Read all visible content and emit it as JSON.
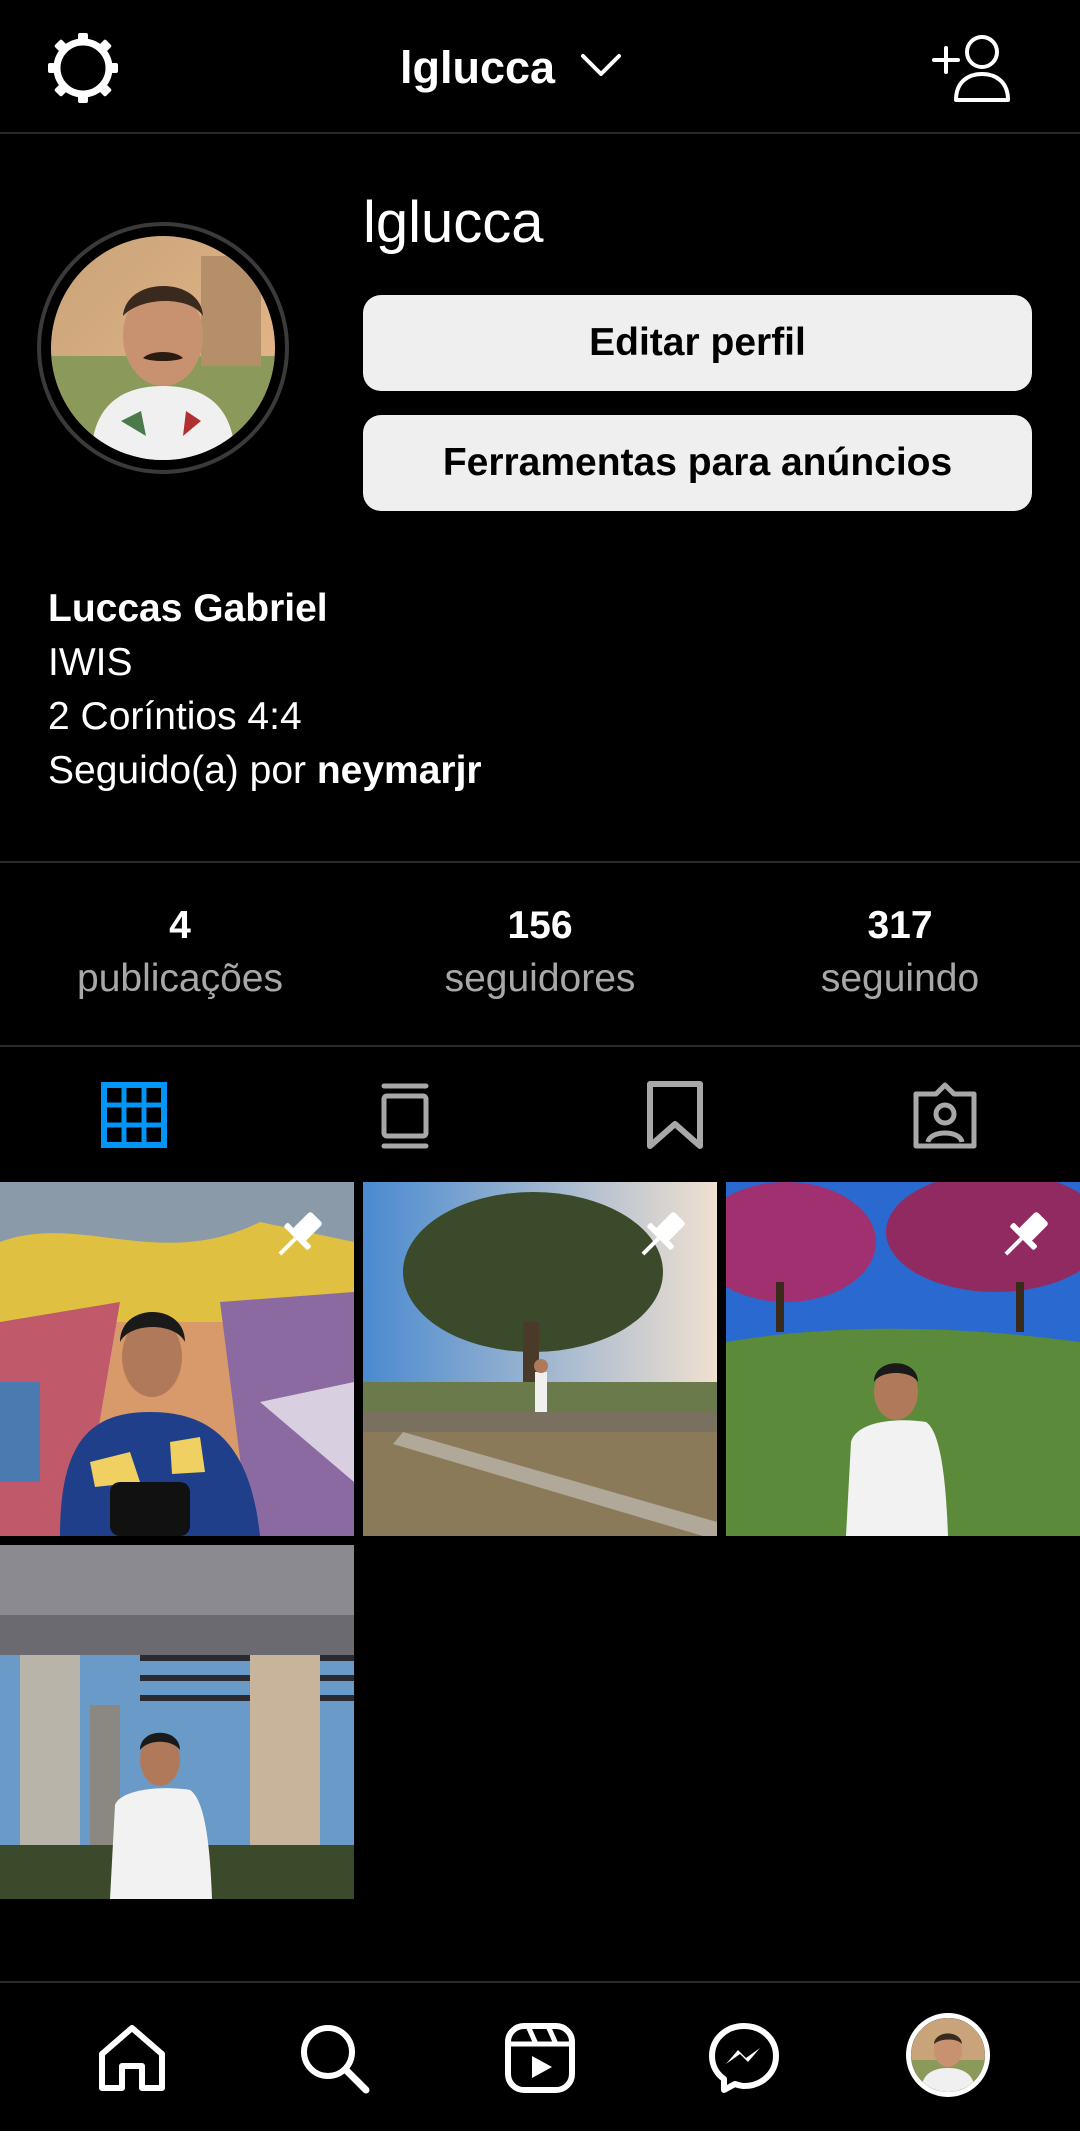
{
  "header": {
    "settings_icon": "settings-gear-icon",
    "account_name": "lglucca",
    "dropdown_icon": "chevron-down-icon",
    "add_user_icon": "add-user-icon"
  },
  "profile": {
    "username": "lglucca",
    "edit_button": "Editar perfil",
    "ads_button": "Ferramentas para anúncios",
    "full_name": "Luccas Gabriel",
    "bio_line1": "IWIS",
    "bio_line2": "2 Coríntios 4:4",
    "followed_by_prefix": "Seguido(a) por ",
    "followed_by_user": "neymarjr"
  },
  "stats": [
    {
      "value": "4",
      "label": "publicações"
    },
    {
      "value": "156",
      "label": "seguidores"
    },
    {
      "value": "317",
      "label": "seguindo"
    }
  ],
  "tabs": [
    {
      "icon": "grid-icon",
      "active": true
    },
    {
      "icon": "guides-icon",
      "active": false
    },
    {
      "icon": "bookmark-icon",
      "active": false
    },
    {
      "icon": "tagged-icon",
      "active": false
    }
  ],
  "posts": [
    {
      "scene": "man in blue Versace shirt before colorful mural",
      "pinned": true
    },
    {
      "scene": "man standing on log by tree and pond",
      "pinned": true
    },
    {
      "scene": "man in white jersey under purple-flower trees",
      "pinned": true
    },
    {
      "scene": "man in white jersey between tall columns",
      "pinned": false
    }
  ],
  "bottom_nav": [
    {
      "icon": "home-icon"
    },
    {
      "icon": "search-icon"
    },
    {
      "icon": "reels-icon"
    },
    {
      "icon": "messenger-icon"
    },
    {
      "icon": "profile-avatar"
    }
  ],
  "colors": {
    "background": "#000000",
    "accent_blue": "#0095f6",
    "button_bg": "#efefef",
    "muted_text": "#a8a8a8"
  }
}
